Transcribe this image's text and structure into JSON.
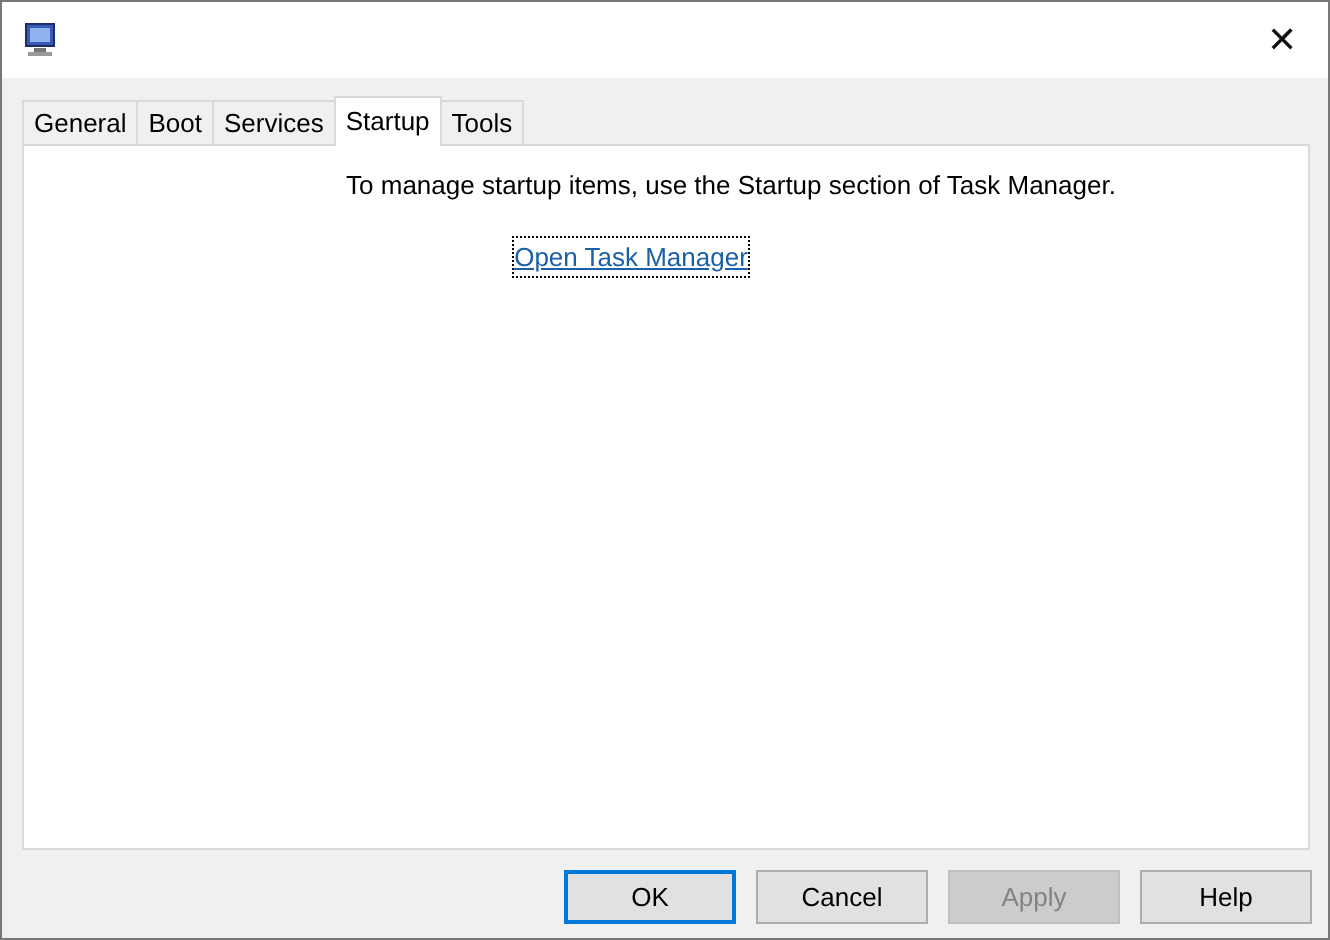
{
  "window": {
    "close": "✕"
  },
  "tabs": [
    {
      "label": "General",
      "selected": false
    },
    {
      "label": "Boot",
      "selected": false
    },
    {
      "label": "Services",
      "selected": false
    },
    {
      "label": "Startup",
      "selected": true
    },
    {
      "label": "Tools",
      "selected": false
    }
  ],
  "panel": {
    "message": "To manage startup items, use the Startup section of Task Manager.",
    "link": "Open Task Manager"
  },
  "buttons": [
    {
      "label": "OK",
      "default": true,
      "disabled": false
    },
    {
      "label": "Cancel",
      "default": false,
      "disabled": false
    },
    {
      "label": "Apply",
      "default": false,
      "disabled": true
    },
    {
      "label": "Help",
      "default": false,
      "disabled": false
    }
  ]
}
